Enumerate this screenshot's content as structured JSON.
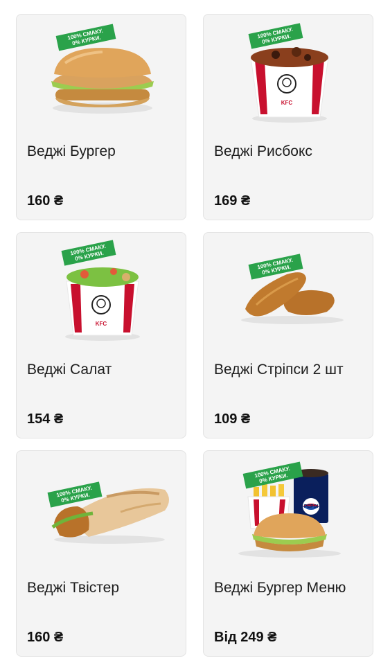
{
  "badge": {
    "line1": "100% СМАКУ.",
    "line2": "0% КУРКИ.",
    "color": "#2aa24a"
  },
  "brand": {
    "bucket_logo": "KFC",
    "drink_logo": "PEPSI"
  },
  "products": [
    {
      "name": "Веджі Бургер",
      "price": "160 ₴",
      "image": "burger-image"
    },
    {
      "name": "Веджі Рисбокс",
      "price": "169 ₴",
      "image": "ricebox-image"
    },
    {
      "name": "Веджі Салат",
      "price": "154 ₴",
      "image": "salad-image"
    },
    {
      "name": "Веджі Стріпси 2 шт",
      "price": "109 ₴",
      "image": "strips-image"
    },
    {
      "name": "Веджі Твістер",
      "price": "160 ₴",
      "image": "twister-image"
    },
    {
      "name": "Веджі Бургер Меню",
      "price": "Від 249 ₴",
      "image": "burger-menu-image"
    }
  ],
  "colors": {
    "card_bg": "#f4f4f4",
    "text": "#1c1c1c",
    "kfc_red": "#c8102e"
  }
}
